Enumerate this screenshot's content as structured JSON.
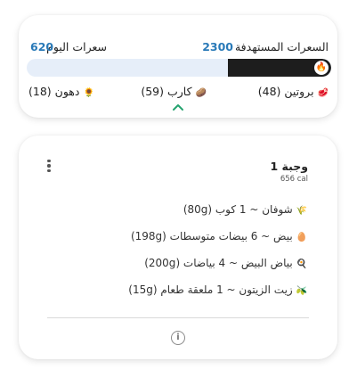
{
  "summary": {
    "target_label": "السعرات المستهدفة",
    "target_value": "2300",
    "today_label": "سعرات اليوم",
    "today_value": "620",
    "progress_fraction": 0.34,
    "flame_icon": "🔥",
    "macros": [
      {
        "label": "بروتين (48)",
        "icon": "🥩"
      },
      {
        "label": "كارب (59)",
        "icon": "🥔"
      },
      {
        "label": "دهون (18)",
        "icon": "🌻"
      }
    ]
  },
  "meal": {
    "title": "وجبة 1",
    "calories": "656 cal",
    "items": [
      {
        "text": "شوفان ~ 1 كوب (80g)",
        "icon": "🌾"
      },
      {
        "text": "بيض ~ 6 بيضات متوسطات (198g)",
        "icon": "🥚"
      },
      {
        "text": "بياض البيض ~ 4 بياضات (200g)",
        "icon": "🍳"
      },
      {
        "text": "زيت الزيتون ~ 1 ملعقة طعام (15g)",
        "icon": "🫒"
      }
    ],
    "info_icon": "i"
  },
  "colors": {
    "accent_blue": "#2a7ab8",
    "bar_track": "#e6eef9",
    "bar_fill": "#1d1d1d",
    "chevron_green": "#25a36f"
  }
}
